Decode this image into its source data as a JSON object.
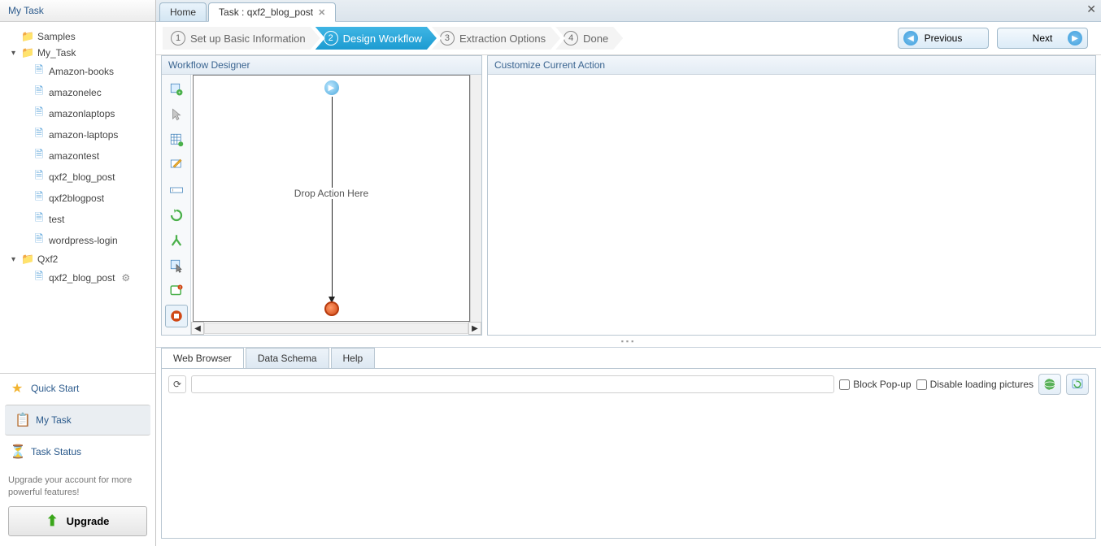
{
  "sidebar": {
    "title": "My Task",
    "tree": {
      "samples": {
        "label": "Samples"
      },
      "my_task": {
        "label": "My_Task",
        "children": [
          "Amazon-books",
          "amazonelec",
          "amazonlaptops",
          "amazon-laptops",
          "amazontest",
          "qxf2_blog_post",
          "qxf2blogpost",
          "test",
          "wordpress-login"
        ]
      },
      "qxf2": {
        "label": "Qxf2",
        "children": [
          "qxf2_blog_post"
        ]
      }
    },
    "nav": {
      "quick_start": "Quick Start",
      "my_task": "My Task",
      "task_status": "Task Status"
    },
    "upgrade_text": "Upgrade your account for more powerful features!",
    "upgrade_btn": "Upgrade"
  },
  "tabs": {
    "home": "Home",
    "task": "Task : qxf2_blog_post"
  },
  "wizard": {
    "steps": [
      "Set up Basic Information",
      "Design Workflow",
      "Extraction Options",
      "Done"
    ],
    "active_index": 1,
    "previous": "Previous",
    "next": "Next"
  },
  "panels": {
    "designer": "Workflow Designer",
    "customize": "Customize Current Action",
    "drop_hint": "Drop Action Here"
  },
  "bottom": {
    "tabs": {
      "web": "Web Browser",
      "schema": "Data Schema",
      "help": "Help"
    },
    "block_popup": "Block Pop-up",
    "disable_pictures": "Disable loading pictures",
    "url_value": ""
  }
}
